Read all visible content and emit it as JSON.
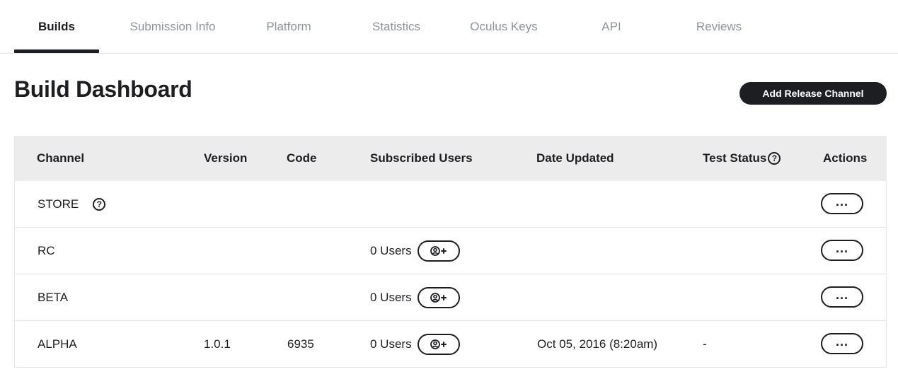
{
  "tabs": [
    "Builds",
    "Submission Info",
    "Platform",
    "Statistics",
    "Oculus Keys",
    "API",
    "Reviews"
  ],
  "active_tab": "Builds",
  "page_title": "Build Dashboard",
  "add_button_label": "Add Release Channel",
  "table": {
    "headers": {
      "channel": "Channel",
      "version": "Version",
      "code": "Code",
      "subscribed_users": "Subscribed Users",
      "date_updated": "Date Updated",
      "test_status": "Test Status",
      "actions": "Actions"
    },
    "rows": [
      {
        "channel": "STORE",
        "version": "",
        "code": "",
        "users": "",
        "date": "",
        "test_status": ""
      },
      {
        "channel": "RC",
        "version": "",
        "code": "",
        "users": "0 Users",
        "date": "",
        "test_status": ""
      },
      {
        "channel": "BETA",
        "version": "",
        "code": "",
        "users": "0 Users",
        "date": "",
        "test_status": ""
      },
      {
        "channel": "ALPHA",
        "version": "1.0.1",
        "code": "6935",
        "users": "0 Users",
        "date": "Oct 05, 2016 (8:20am)",
        "test_status": "-"
      }
    ]
  },
  "icons": {
    "help": "question-circle-icon",
    "add_user": "add-user-icon",
    "more": "more-horizontal-icon"
  },
  "colors": {
    "text": "#1c1e21",
    "muted_tab": "#8d949e",
    "header_bg": "#ececec",
    "button_bg": "#1c1e21"
  }
}
